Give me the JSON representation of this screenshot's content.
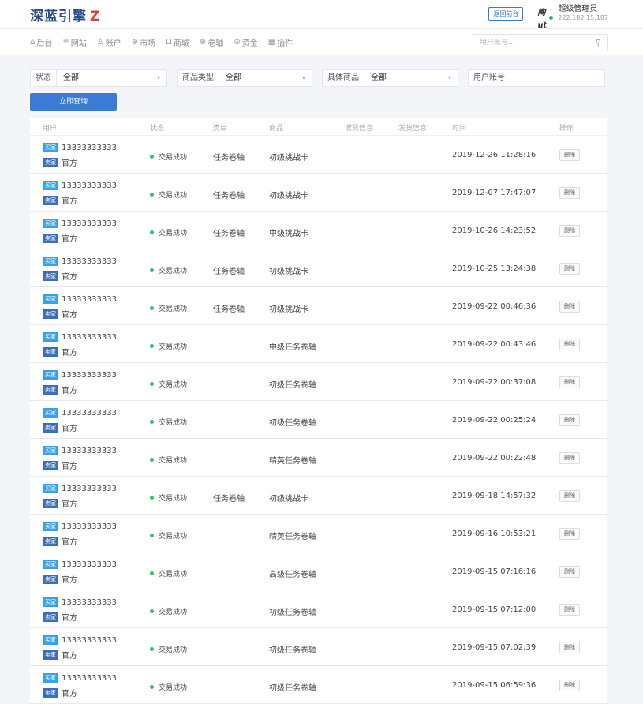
{
  "header": {
    "logo_text": "深蓝引擎",
    "logo_mark": "Z",
    "back_button": "返回前台",
    "avatar_text": "陶ut",
    "user_role": "超级管理员",
    "user_ip": "222.182.15.187"
  },
  "nav": {
    "items": [
      {
        "icon": "⌂",
        "label": "后台"
      },
      {
        "icon": "≡",
        "label": "网站"
      },
      {
        "icon": "♙",
        "label": "账户"
      },
      {
        "icon": "⊕",
        "label": "市场"
      },
      {
        "icon": "⊔",
        "label": "商城"
      },
      {
        "icon": "⊕",
        "label": "卷轴"
      },
      {
        "icon": "⊛",
        "label": "资金"
      },
      {
        "icon": "▦",
        "label": "插件"
      }
    ],
    "search_placeholder": "用户账号..."
  },
  "filters": {
    "status_label": "状态",
    "status_value": "全部",
    "type_label": "商品类型",
    "type_value": "全部",
    "item_label": "具体商品",
    "item_value": "全部",
    "account_label": "用户账号",
    "account_value": ""
  },
  "query_button": "立即查询",
  "table": {
    "headers": [
      "用户",
      "状态",
      "类目",
      "商品",
      "收货信息",
      "发货信息",
      "时间",
      "操作"
    ],
    "buyer_badge": "买家",
    "seller_badge": "卖家",
    "delete_label": "删除",
    "rows": [
      {
        "buyer": "13333333333",
        "seller": "官方",
        "status": "交易成功",
        "category": "任务卷轴",
        "product": "初级挑战卡",
        "time": "2019-12-26 11:28:16"
      },
      {
        "buyer": "13333333333",
        "seller": "官方",
        "status": "交易成功",
        "category": "任务卷轴",
        "product": "初级挑战卡",
        "time": "2019-12-07 17:47:07"
      },
      {
        "buyer": "13333333333",
        "seller": "官方",
        "status": "交易成功",
        "category": "任务卷轴",
        "product": "中级挑战卡",
        "time": "2019-10-26 14:23:52"
      },
      {
        "buyer": "13333333333",
        "seller": "官方",
        "status": "交易成功",
        "category": "任务卷轴",
        "product": "初级挑战卡",
        "time": "2019-10-25 13:24:38"
      },
      {
        "buyer": "13333333333",
        "seller": "官方",
        "status": "交易成功",
        "category": "任务卷轴",
        "product": "初级挑战卡",
        "time": "2019-09-22 00:46:36"
      },
      {
        "buyer": "13333333333",
        "seller": "官方",
        "status": "交易成功",
        "category": "",
        "product": "中级任务卷轴",
        "time": "2019-09-22 00:43:46"
      },
      {
        "buyer": "13333333333",
        "seller": "官方",
        "status": "交易成功",
        "category": "",
        "product": "初级任务卷轴",
        "time": "2019-09-22 00:37:08"
      },
      {
        "buyer": "13333333333",
        "seller": "官方",
        "status": "交易成功",
        "category": "",
        "product": "初级任务卷轴",
        "time": "2019-09-22 00:25:24"
      },
      {
        "buyer": "13333333333",
        "seller": "官方",
        "status": "交易成功",
        "category": "",
        "product": "精英任务卷轴",
        "time": "2019-09-22 00:22:48"
      },
      {
        "buyer": "13333333333",
        "seller": "官方",
        "status": "交易成功",
        "category": "任务卷轴",
        "product": "初级挑战卡",
        "time": "2019-09-18 14:57:32"
      },
      {
        "buyer": "13333333333",
        "seller": "官方",
        "status": "交易成功",
        "category": "",
        "product": "精英任务卷轴",
        "time": "2019-09-16 10:53:21"
      },
      {
        "buyer": "13333333333",
        "seller": "官方",
        "status": "交易成功",
        "category": "",
        "product": "高级任务卷轴",
        "time": "2019-09-15 07:16:16"
      },
      {
        "buyer": "13333333333",
        "seller": "官方",
        "status": "交易成功",
        "category": "",
        "product": "初级任务卷轴",
        "time": "2019-09-15 07:12:00"
      },
      {
        "buyer": "13333333333",
        "seller": "官方",
        "status": "交易成功",
        "category": "",
        "product": "初级任务卷轴",
        "time": "2019-09-15 07:02:39"
      },
      {
        "buyer": "13333333333",
        "seller": "官方",
        "status": "交易成功",
        "category": "",
        "product": "初级任务卷轴",
        "time": "2019-09-15 06:59:36"
      }
    ]
  },
  "colors": {
    "accent": "#3a7bd5",
    "buyer_badge": "#3aa1e8",
    "seller_badge": "#3c6fb8",
    "success_dot": "#36c26a",
    "logo_blue": "#2b4a8a",
    "logo_red": "#e23b3b"
  }
}
